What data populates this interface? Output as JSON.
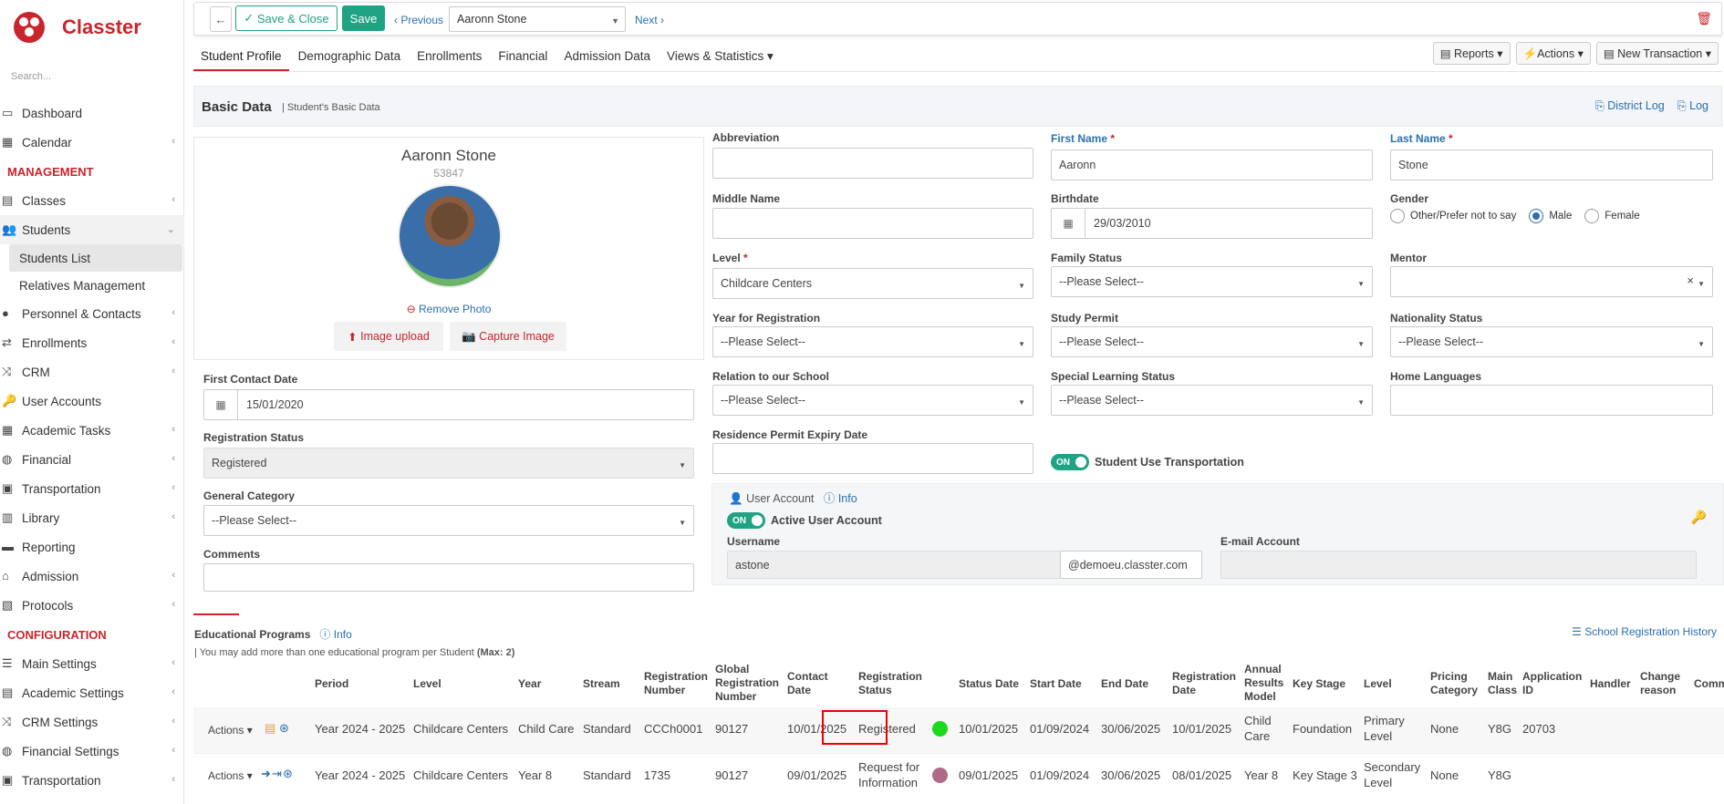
{
  "app": {
    "name": "Classter",
    "search_placeholder": "Search..."
  },
  "sidebar": {
    "top": [
      {
        "label": "Dashboard"
      },
      {
        "label": "Calendar"
      }
    ],
    "management_title": "MANAGEMENT",
    "management": [
      {
        "label": "Classes"
      },
      {
        "label": "Students"
      }
    ],
    "students_sub": [
      {
        "label": "Students List"
      },
      {
        "label": "Relatives Management"
      }
    ],
    "management2": [
      {
        "label": "Personnel & Contacts"
      },
      {
        "label": "Enrollments"
      },
      {
        "label": "CRM"
      },
      {
        "label": "User Accounts"
      },
      {
        "label": "Academic Tasks"
      },
      {
        "label": "Financial"
      },
      {
        "label": "Transportation"
      },
      {
        "label": "Library"
      },
      {
        "label": "Reporting"
      },
      {
        "label": "Admission"
      },
      {
        "label": "Protocols"
      }
    ],
    "configuration_title": "CONFIGURATION",
    "configuration": [
      {
        "label": "Main Settings"
      },
      {
        "label": "Academic Settings"
      },
      {
        "label": "CRM Settings"
      },
      {
        "label": "Financial Settings"
      },
      {
        "label": "Transportation"
      }
    ]
  },
  "toolbar": {
    "save_close": "Save & Close",
    "save": "Save",
    "previous": "Previous",
    "student_select": "Aaronn Stone",
    "next": "Next"
  },
  "tabs": [
    "Student Profile",
    "Demographic Data",
    "Enrollments",
    "Financial",
    "Admission Data",
    "Views & Statistics"
  ],
  "right_buttons": {
    "reports": "Reports",
    "actions": "Actions",
    "new_transaction": "New Transaction"
  },
  "basic": {
    "title": "Basic Data",
    "subtitle": "| Student's Basic Data",
    "district_log": "District Log",
    "log": "Log"
  },
  "profile": {
    "name": "Aaronn Stone",
    "id": "53847",
    "remove_photo": "Remove Photo",
    "image_upload": "Image upload",
    "capture_image": "Capture Image"
  },
  "left_form": {
    "first_contact_label": "First Contact Date",
    "first_contact_value": "15/01/2020",
    "reg_status_label": "Registration Status",
    "reg_status_value": "Registered",
    "general_cat_label": "General Category",
    "general_cat_value": "--Please Select--",
    "comments_label": "Comments"
  },
  "form": {
    "abbreviation": "Abbreviation",
    "first_name_label": "First Name",
    "first_name": "Aaronn",
    "last_name_label": "Last Name",
    "last_name": "Stone",
    "middle_name": "Middle Name",
    "birthdate_label": "Birthdate",
    "birthdate": "29/03/2010",
    "gender_label": "Gender",
    "gender_options": [
      "Other/Prefer not to say",
      "Male",
      "Female"
    ],
    "level_label": "Level",
    "level": "Childcare Centers",
    "family_status": "Family Status",
    "mentor": "Mentor",
    "year_reg": "Year for Registration",
    "study_permit": "Study Permit",
    "nationality_status": "Nationality Status",
    "relation": "Relation to our School",
    "special_learning": "Special Learning Status",
    "home_languages": "Home Languages",
    "residence": "Residence Permit Expiry Date",
    "please_select": "--Please Select--",
    "transport_label": "Student Use Transportation",
    "on": "ON"
  },
  "user_account": {
    "title": "User Account",
    "info": "Info",
    "active_label": "Active User Account",
    "username_label": "Username",
    "username": "astone",
    "domain": "@demoeu.classter.com",
    "email_label": "E-mail Account"
  },
  "programs": {
    "title": "Educational Programs",
    "info": "Info",
    "history": "School Registration History",
    "note": "| You may add more than one educational program per Student",
    "note_max": "(Max: 2)",
    "headers": [
      "Period",
      "Level",
      "Year",
      "Stream",
      "Registration Number",
      "Global Registration Number",
      "Contact Date",
      "Registration Status",
      "Status Date",
      "Start Date",
      "End Date",
      "Registration Date",
      "Annual Results Model",
      "Key Stage",
      "Level",
      "Pricing Category",
      "Main Class",
      "Application ID",
      "Handler",
      "Change reason",
      "Comm"
    ],
    "actions_label": "Actions",
    "rows": [
      {
        "period": "Year 2024 - 2025",
        "level": "Childcare Centers",
        "year": "Child Care",
        "stream": "Standard",
        "reg_no": "CCCh0001",
        "global": "90127",
        "contact": "10/01/2025",
        "status": "Registered",
        "status_color": "#1bd91b",
        "status_date": "10/01/2025",
        "start": "01/09/2024",
        "end": "30/06/2025",
        "reg_date": "10/01/2025",
        "arm": "Child Care",
        "key_stage": "Foundation",
        "level2": "Primary Level",
        "pricing": "None",
        "main_class": "Y8G",
        "app_id": "20703"
      },
      {
        "period": "Year 2024 - 2025",
        "level": "Childcare Centers",
        "year": "Year 8",
        "stream": "Standard",
        "reg_no": "1735",
        "global": "90127",
        "contact": "09/01/2025",
        "status": "Request for Information",
        "status_color": "#b06a86",
        "status_date": "09/01/2025",
        "start": "01/09/2024",
        "end": "30/06/2025",
        "reg_date": "08/01/2025",
        "arm": "Year 8",
        "key_stage": "Key Stage 3",
        "level2": "Secondary Level",
        "pricing": "None",
        "main_class": "Y8G",
        "app_id": ""
      }
    ]
  }
}
